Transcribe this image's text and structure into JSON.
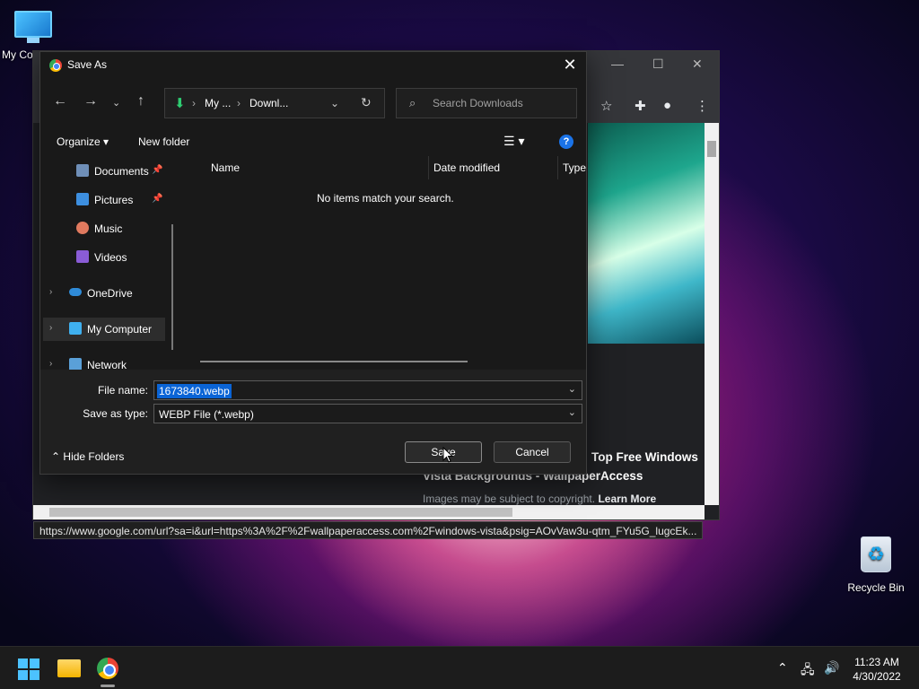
{
  "desktop": {
    "my_computer_label": "My Co",
    "recycle_bin_label": "Recycle Bin"
  },
  "browser": {
    "result_title_line1": "Top Free Windows",
    "result_title_line2": "Vista Backgrounds - WallpaperAccess",
    "result_subtitle": "Images may be subject to copyright.",
    "learn_more": "Learn More",
    "status_url": "https://www.google.com/url?sa=i&url=https%3A%2F%2Fwallpaperaccess.com%2Fwindows-vista&psig=AOvVaw3u-qtm_FYu5G_lugcEk..."
  },
  "dialog": {
    "title": "Save As",
    "address_parts": [
      "My ...",
      "Downl..."
    ],
    "search_placeholder": "Search Downloads",
    "organize_label": "Organize",
    "new_folder_label": "New folder",
    "help_label": "?",
    "nav_items": [
      {
        "label": "Documents",
        "pinned": true
      },
      {
        "label": "Pictures",
        "pinned": true
      },
      {
        "label": "Music"
      },
      {
        "label": "Videos"
      },
      {
        "label": "OneDrive"
      },
      {
        "label": "My Computer",
        "selected": true
      },
      {
        "label": "Network"
      }
    ],
    "columns": [
      "Name",
      "Date modified",
      "Type"
    ],
    "empty_message": "No items match your search.",
    "file_name_label": "File name:",
    "file_name_value": "1673840.webp",
    "save_type_label": "Save as type:",
    "save_type_value": "WEBP File (*.webp)",
    "hide_folders_label": "Hide Folders",
    "save_label": "Save",
    "cancel_label": "Cancel"
  },
  "taskbar": {
    "time": "11:23 AM",
    "date": "4/30/2022"
  },
  "icons": {
    "close": "close-icon",
    "back": "back-arrow-icon",
    "forward": "forward-arrow-icon",
    "up": "up-arrow-icon",
    "refresh": "refresh-icon",
    "search": "search-icon"
  },
  "colors": {
    "accent": "#0a64d6",
    "help": "#1a73e8",
    "download_icon": "#2ecc71"
  }
}
